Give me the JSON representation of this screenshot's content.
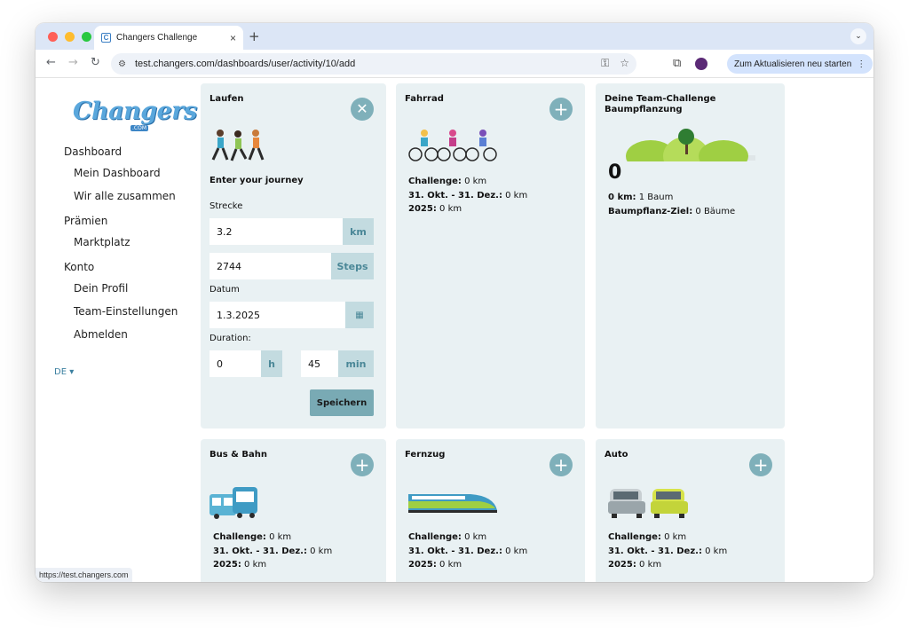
{
  "browser": {
    "tab_title": "Changers Challenge",
    "tab_close": "×",
    "new_tab": "+",
    "url": "test.changers.com/dashboards/user/activity/10/add",
    "update_button": "Zum Aktualisieren neu starten",
    "status_url": "https://test.changers.com",
    "colors": {
      "tabstrip": "#dce6f6",
      "close": "#ff5f57",
      "min": "#febc2e",
      "max": "#28c840"
    }
  },
  "sidebar": {
    "logo": "Changers",
    "logo_sub": ".COM",
    "sections": [
      {
        "title": "Dashboard",
        "items": [
          "Mein Dashboard",
          "Wir alle zusammen"
        ]
      },
      {
        "title": "Prämien",
        "items": [
          "Marktplatz"
        ]
      },
      {
        "title": "Konto",
        "items": [
          "Dein Profil",
          "Team-Einstellungen",
          "Abmelden"
        ]
      }
    ],
    "language": "DE ▾"
  },
  "laufen": {
    "title": "Laufen",
    "icon": "runners-illustration",
    "journey_heading": "Enter your journey",
    "strecke_label": "Strecke",
    "distance_value": "3.2",
    "distance_unit": "km",
    "steps_value": "2744",
    "steps_unit": "Steps",
    "datum_label": "Datum",
    "date_value": "1.3.2025",
    "duration_label": "Duration:",
    "hours_value": "0",
    "hours_unit": "h",
    "minutes_value": "45",
    "minutes_unit": "min",
    "save_label": "Speichern"
  },
  "fahrrad": {
    "title": "Fahrrad",
    "icon": "cyclists-illustration",
    "challenge_label": "Challenge:",
    "challenge_value": "0 km",
    "period_label": "31. Okt. - 31. Dez.:",
    "period_value": "0 km",
    "year_label": "2025:",
    "year_value": "0 km"
  },
  "team": {
    "title_line1": "Deine Team-Challenge",
    "title_line2": "Baumpflanzung",
    "icon": "tree-hills-illustration",
    "count": "0",
    "km_label": "0 km:",
    "km_value": "1 Baum",
    "goal_label": "Baumpflanz-Ziel:",
    "goal_value": "0 Bäume"
  },
  "bus": {
    "title": "Bus & Bahn",
    "icon": "bus-tram-illustration",
    "challenge_label": "Challenge:",
    "challenge_value": "0 km",
    "period_label": "31. Okt. - 31. Dez.:",
    "period_value": "0 km",
    "year_label": "2025:",
    "year_value": "0 km"
  },
  "fernzug": {
    "title": "Fernzug",
    "icon": "train-illustration",
    "challenge_label": "Challenge:",
    "challenge_value": "0 km",
    "period_label": "31. Okt. - 31. Dez.:",
    "period_value": "0 km",
    "year_label": "2025:",
    "year_value": "0 km"
  },
  "auto": {
    "title": "Auto",
    "icon": "cars-illustration",
    "challenge_label": "Challenge:",
    "challenge_value": "0 km",
    "period_label": "31. Okt. - 31. Dez.:",
    "period_value": "0 km",
    "year_label": "2025:",
    "year_value": "0 km"
  }
}
